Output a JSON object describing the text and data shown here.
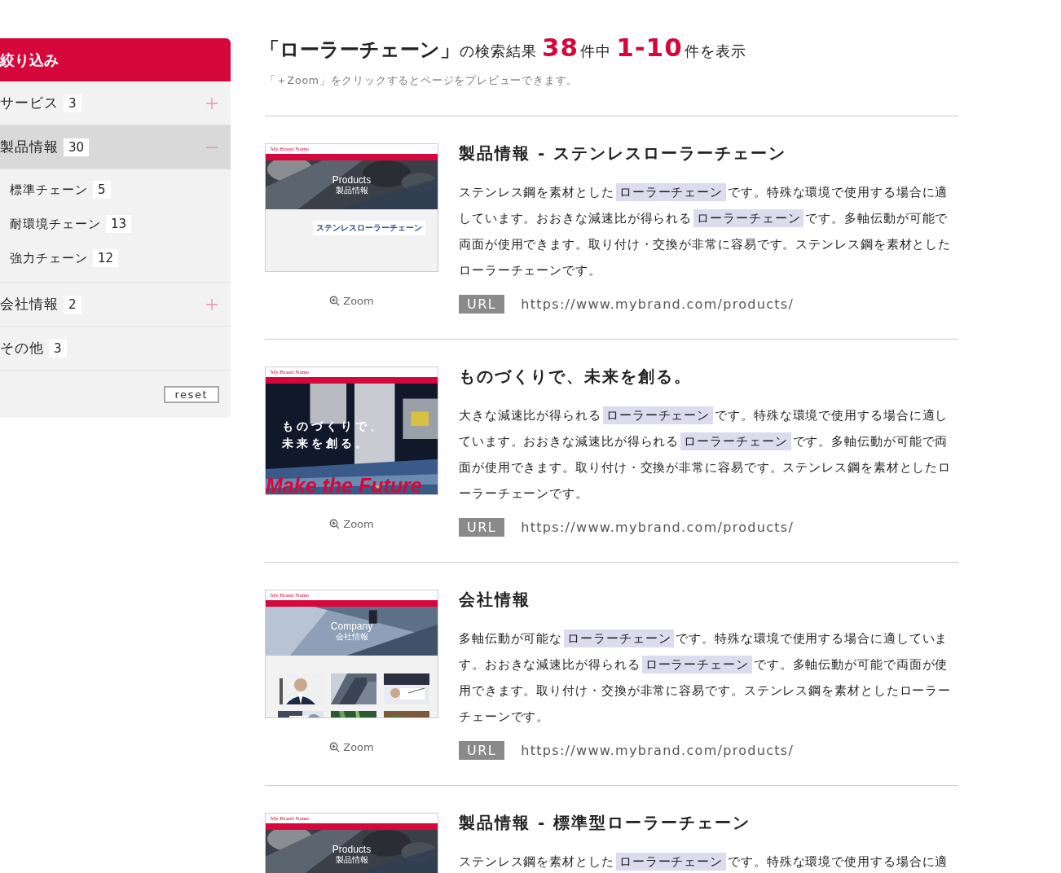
{
  "sidebar": {
    "title": "絞り込み",
    "items": [
      {
        "label": "サービス",
        "count": "3",
        "expanded": false
      },
      {
        "label": "製品情報",
        "count": "30",
        "expanded": true,
        "children": [
          {
            "label": "標準チェーン",
            "count": "5"
          },
          {
            "label": "耐環境チェーン",
            "count": "13"
          },
          {
            "label": "強力チェーン",
            "count": "12"
          }
        ]
      },
      {
        "label": "会社情報",
        "count": "2",
        "expanded": false
      },
      {
        "label": "その他",
        "count": "3"
      }
    ],
    "reset_button": "reset"
  },
  "header": {
    "parts": [
      {
        "kind": "query",
        "text": "「ローラーチェーン」"
      },
      {
        "kind": "text",
        "text": "の検索結果"
      },
      {
        "kind": "count",
        "text": "38"
      },
      {
        "kind": "text",
        "text": "件中"
      },
      {
        "kind": "count",
        "text": "1-10"
      },
      {
        "kind": "text",
        "text": "件を表示"
      }
    ],
    "hint": "「＋Zoom」をクリックするとページをプレビューできます。"
  },
  "results": [
    {
      "thumbnail": {
        "kind": "products",
        "brand": "My Brand Name",
        "hero_title": "Products",
        "hero_subtitle": "製品情報",
        "page_title": "ステンレスローラーチェーン"
      },
      "zoom": "Zoom",
      "title": "製品情報 - ステンレスローラーチェーン",
      "snippet": [
        {
          "text": "ステンレス鋼を素材とした",
          "highlight": false
        },
        {
          "text": "ローラーチェーン",
          "highlight": true
        },
        {
          "text": "です。特殊な環境で使用する場合に適しています。おおきな減速比が得られる",
          "highlight": false
        },
        {
          "text": "ローラーチェーン",
          "highlight": true
        },
        {
          "text": "です。多軸伝動が可能で両面が使用できます。取り付け・交換が非常に容易です。ステンレス鋼を素材としたローラーチェーンです。",
          "highlight": false
        }
      ],
      "url_label": "URL",
      "url": "https://www.mybrand.com/products/"
    },
    {
      "thumbnail": {
        "kind": "hero",
        "brand": "My Brand Name",
        "hero_lines": [
          "ものづくりで、",
          "未来を創る。"
        ],
        "slogan": "Make the Future"
      },
      "zoom": "Zoom",
      "title": "ものづくりで、未来を創る。",
      "snippet": [
        {
          "text": "大きな減速比が得られる",
          "highlight": false
        },
        {
          "text": "ローラーチェーン",
          "highlight": true
        },
        {
          "text": "です。特殊な環境で使用する場合に適しています。おおきな減速比が得られる",
          "highlight": false
        },
        {
          "text": "ローラーチェーン",
          "highlight": true
        },
        {
          "text": "です。多軸伝動が可能で両面が使用できます。取り付け・交換が非常に容易です。ステンレス鋼を素材としたローラーチェーンです。",
          "highlight": false
        }
      ],
      "url_label": "URL",
      "url": "https://www.mybrand.com/products/"
    },
    {
      "thumbnail": {
        "kind": "company",
        "brand": "My Brand Name",
        "hero_title": "Company",
        "hero_subtitle": "会社情報"
      },
      "zoom": "Zoom",
      "title": "会社情報",
      "snippet": [
        {
          "text": "多軸伝動が可能な",
          "highlight": false
        },
        {
          "text": "ローラーチェーン",
          "highlight": true
        },
        {
          "text": "です。特殊な環境で使用する場合に適しています。おおきな減速比が得られる",
          "highlight": false
        },
        {
          "text": "ローラーチェーン",
          "highlight": true
        },
        {
          "text": "です。多軸伝動が可能で両面が使用できます。取り付け・交換が非常に容易です。ステンレス鋼を素材としたローラーチェーンです。",
          "highlight": false
        }
      ],
      "url_label": "URL",
      "url": "https://www.mybrand.com/products/"
    },
    {
      "thumbnail": {
        "kind": "products",
        "brand": "My Brand Name",
        "hero_title": "Products",
        "hero_subtitle": "製品情報"
      },
      "title": "製品情報 - 標準型ローラーチェーン",
      "snippet": [
        {
          "text": "ステンレス鋼を素材とした",
          "highlight": false
        },
        {
          "text": "ローラーチェーン",
          "highlight": true
        },
        {
          "text": "です。特殊な環境で使用する場合に適",
          "highlight": false
        }
      ]
    }
  ]
}
